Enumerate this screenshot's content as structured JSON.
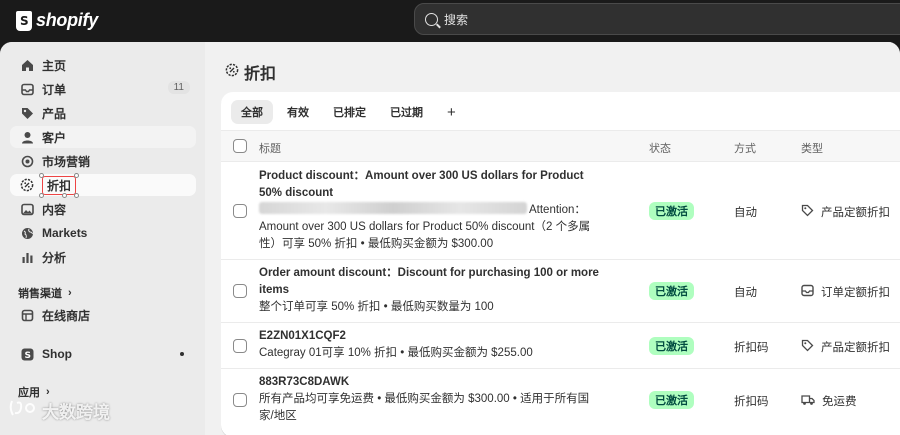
{
  "brand": {
    "name": "shopify"
  },
  "search": {
    "placeholder": "搜索"
  },
  "sidebar": {
    "items": [
      {
        "label": "主页",
        "icon": "home-icon"
      },
      {
        "label": "订单",
        "icon": "inbox-icon",
        "badge": "11"
      },
      {
        "label": "产品",
        "icon": "tag-icon"
      },
      {
        "label": "客户",
        "icon": "person-icon"
      },
      {
        "label": "市场营销",
        "icon": "target-icon"
      },
      {
        "label": "折扣",
        "icon": "discount-icon"
      },
      {
        "label": "内容",
        "icon": "image-icon"
      },
      {
        "label": "Markets",
        "icon": "globe-icon"
      },
      {
        "label": "分析",
        "icon": "bar-chart-icon"
      }
    ],
    "sales_channels_label": "销售渠道",
    "online_store_label": "在线商店",
    "shop_label": "Shop",
    "apps_label": "应用"
  },
  "watermark": {
    "text": "大数跨境"
  },
  "page": {
    "title": "折扣"
  },
  "tabs": [
    "全部",
    "有效",
    "已排定",
    "已过期"
  ],
  "table": {
    "headers": {
      "title": "标题",
      "status": "状态",
      "method": "方式",
      "type": "类型"
    },
    "rows": [
      {
        "title": "Product discount：Amount over 300 US dollars for Product 50% discount",
        "desc_suffix": "Attention：Amount over 300 US dollars for Product 50% discount（2 个多属性）可享 50% 折扣 • 最低购买金额为 $300.00",
        "status": "已激活",
        "method": "自动",
        "type": "产品定额折扣",
        "type_icon": "tag-icon"
      },
      {
        "title": "Order amount discount：Discount for purchasing 100 or more items",
        "desc": "整个订单可享 50% 折扣 • 最低购买数量为 100",
        "status": "已激活",
        "method": "自动",
        "type": "订单定额折扣",
        "type_icon": "inbox-icon"
      },
      {
        "title": "E2ZN01X1CQF2",
        "desc": "Categray 01可享 10% 折扣 • 最低购买金额为 $255.00",
        "status": "已激活",
        "method": "折扣码",
        "type": "产品定额折扣",
        "type_icon": "tag-icon"
      },
      {
        "title": "883R73C8DAWK",
        "desc": "所有产品均可享免运费 • 最低购买金额为 $300.00 • 适用于所有国家/地区",
        "status": "已激活",
        "method": "折扣码",
        "type": "免运费",
        "type_icon": "truck-icon"
      }
    ]
  },
  "colors": {
    "status_bg": "#affebf",
    "status_text": "#014b40",
    "topbar": "#1a1a1a"
  }
}
